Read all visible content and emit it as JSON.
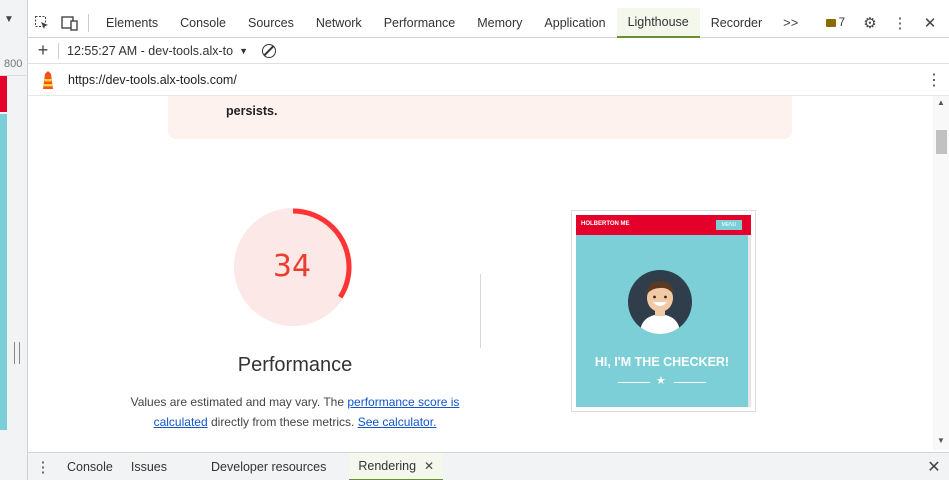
{
  "page_strip": {
    "ruler_label": "800"
  },
  "toolbar": {
    "tabs": [
      "Elements",
      "Console",
      "Sources",
      "Network",
      "Performance",
      "Memory",
      "Application",
      "Lighthouse",
      "Recorder"
    ],
    "active_tab": "Lighthouse",
    "more_tabs_label": ">>",
    "issues_count": "7"
  },
  "lighthouse": {
    "new_report_label": "+",
    "report_selector": "12:55:27 AM - dev-tools.alx-to",
    "url": "https://dev-tools.alx-tools.com/"
  },
  "report": {
    "warning_text": "persists.",
    "score": "34",
    "category_title": "Performance",
    "desc_before": "Values are estimated and may vary. The ",
    "desc_link1": "performance score is calculated",
    "desc_middle": " directly from these metrics. ",
    "desc_link2": "See calculator.",
    "score_fraction": 0.34,
    "gauge_color": "#ff3333",
    "gauge_bg": "#fce8e6"
  },
  "screenshot": {
    "brand": "HOLBERTON ME",
    "menu": "MENU",
    "headline": "HI, I'M THE CHECKER!"
  },
  "drawer": {
    "tabs": [
      "Console",
      "Issues",
      "Developer resources",
      "Rendering"
    ],
    "active_tab": "Rendering"
  }
}
